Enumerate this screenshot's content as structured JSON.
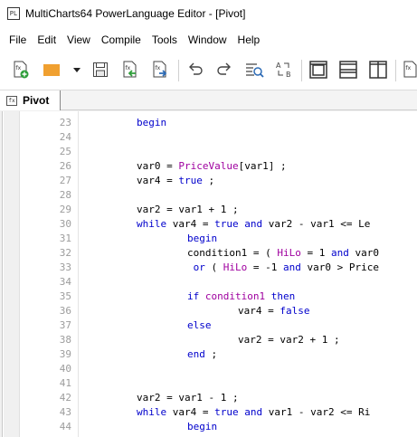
{
  "window": {
    "title": "MultiCharts64 PowerLanguage Editor - [Pivot]"
  },
  "menu": [
    "File",
    "Edit",
    "View",
    "Compile",
    "Tools",
    "Window",
    "Help"
  ],
  "toolbar": {
    "icons": [
      "new-study-icon",
      "open-study-icon",
      "dropdown-arrow-icon",
      "save-icon",
      "compile-icon",
      "verify-icon",
      "undo-icon",
      "redo-icon",
      "find-icon",
      "replace-icon",
      "cascade-icon",
      "tile-horizontal-icon",
      "tile-vertical-icon",
      "more-icon"
    ],
    "colors": {
      "orange": "#f0a030",
      "green": "#2e9e3a",
      "blue": "#2d6bb5",
      "dark": "#444444"
    }
  },
  "tab": {
    "label": "Pivot"
  },
  "code_colors": {
    "keyword": "#0000cc",
    "function": "#9f009f",
    "line_number": "#9c9c9c"
  },
  "code": {
    "lines": [
      {
        "n": "23",
        "indent": 0,
        "segments": [
          [
            "kw",
            "begin"
          ]
        ]
      },
      {
        "n": "24",
        "indent": 0,
        "segments": []
      },
      {
        "n": "25",
        "indent": 0,
        "segments": []
      },
      {
        "n": "26",
        "indent": 0,
        "segments": [
          [
            "",
            "var0 = "
          ],
          [
            "fn",
            "PriceValue"
          ],
          [
            "",
            "[var1] ;"
          ]
        ]
      },
      {
        "n": "27",
        "indent": 0,
        "segments": [
          [
            "",
            "var4 = "
          ],
          [
            "kw",
            "true"
          ],
          [
            "",
            " ;"
          ]
        ]
      },
      {
        "n": "28",
        "indent": 0,
        "segments": []
      },
      {
        "n": "29",
        "indent": 0,
        "segments": [
          [
            "",
            "var2 = var1 + "
          ],
          [
            "num",
            "1"
          ],
          [
            "",
            " ;"
          ]
        ]
      },
      {
        "n": "30",
        "indent": 0,
        "segments": [
          [
            "kw",
            "while"
          ],
          [
            "",
            " var4 = "
          ],
          [
            "kw",
            "true"
          ],
          [
            "",
            " "
          ],
          [
            "kw",
            "and"
          ],
          [
            "",
            " var2 - var1 <= Le"
          ]
        ]
      },
      {
        "n": "31",
        "indent": 1,
        "segments": [
          [
            "kw",
            "begin"
          ]
        ]
      },
      {
        "n": "32",
        "indent": 1,
        "segments": [
          [
            "",
            "condition1 = ( "
          ],
          [
            "fn",
            "HiLo"
          ],
          [
            "",
            " = "
          ],
          [
            "num",
            "1"
          ],
          [
            "",
            " "
          ],
          [
            "kw",
            "and"
          ],
          [
            "",
            " var0"
          ]
        ]
      },
      {
        "n": "33",
        "indent": 1,
        "segments": [
          [
            "",
            " "
          ],
          [
            "kw",
            "or"
          ],
          [
            "",
            " ( "
          ],
          [
            "fn",
            "HiLo"
          ],
          [
            "",
            " = "
          ],
          [
            "num",
            "-1"
          ],
          [
            "",
            " "
          ],
          [
            "kw",
            "and"
          ],
          [
            "",
            " var0 > Price"
          ]
        ]
      },
      {
        "n": "34",
        "indent": 0,
        "segments": []
      },
      {
        "n": "35",
        "indent": 1,
        "segments": [
          [
            "kw",
            "if"
          ],
          [
            "",
            " "
          ],
          [
            "fn",
            "condition1"
          ],
          [
            "",
            " "
          ],
          [
            "kw",
            "then"
          ]
        ]
      },
      {
        "n": "36",
        "indent": 2,
        "segments": [
          [
            "",
            "var4 = "
          ],
          [
            "kw",
            "false"
          ]
        ]
      },
      {
        "n": "37",
        "indent": 1,
        "segments": [
          [
            "kw",
            "else"
          ]
        ]
      },
      {
        "n": "38",
        "indent": 2,
        "segments": [
          [
            "",
            "var2 = var2 + "
          ],
          [
            "num",
            "1"
          ],
          [
            "",
            " ;"
          ]
        ]
      },
      {
        "n": "39",
        "indent": 1,
        "segments": [
          [
            "kw",
            "end"
          ],
          [
            "",
            " ;"
          ]
        ]
      },
      {
        "n": "40",
        "indent": 0,
        "segments": []
      },
      {
        "n": "41",
        "indent": 0,
        "segments": []
      },
      {
        "n": "42",
        "indent": 0,
        "segments": [
          [
            "",
            "var2 = var1 - "
          ],
          [
            "num",
            "1"
          ],
          [
            "",
            " ;"
          ]
        ]
      },
      {
        "n": "43",
        "indent": 0,
        "segments": [
          [
            "kw",
            "while"
          ],
          [
            "",
            " var4 = "
          ],
          [
            "kw",
            "true"
          ],
          [
            "",
            " "
          ],
          [
            "kw",
            "and"
          ],
          [
            "",
            " var1 - var2 <= Ri"
          ]
        ]
      },
      {
        "n": "44",
        "indent": 1,
        "segments": [
          [
            "kw",
            "begin"
          ]
        ]
      }
    ]
  }
}
